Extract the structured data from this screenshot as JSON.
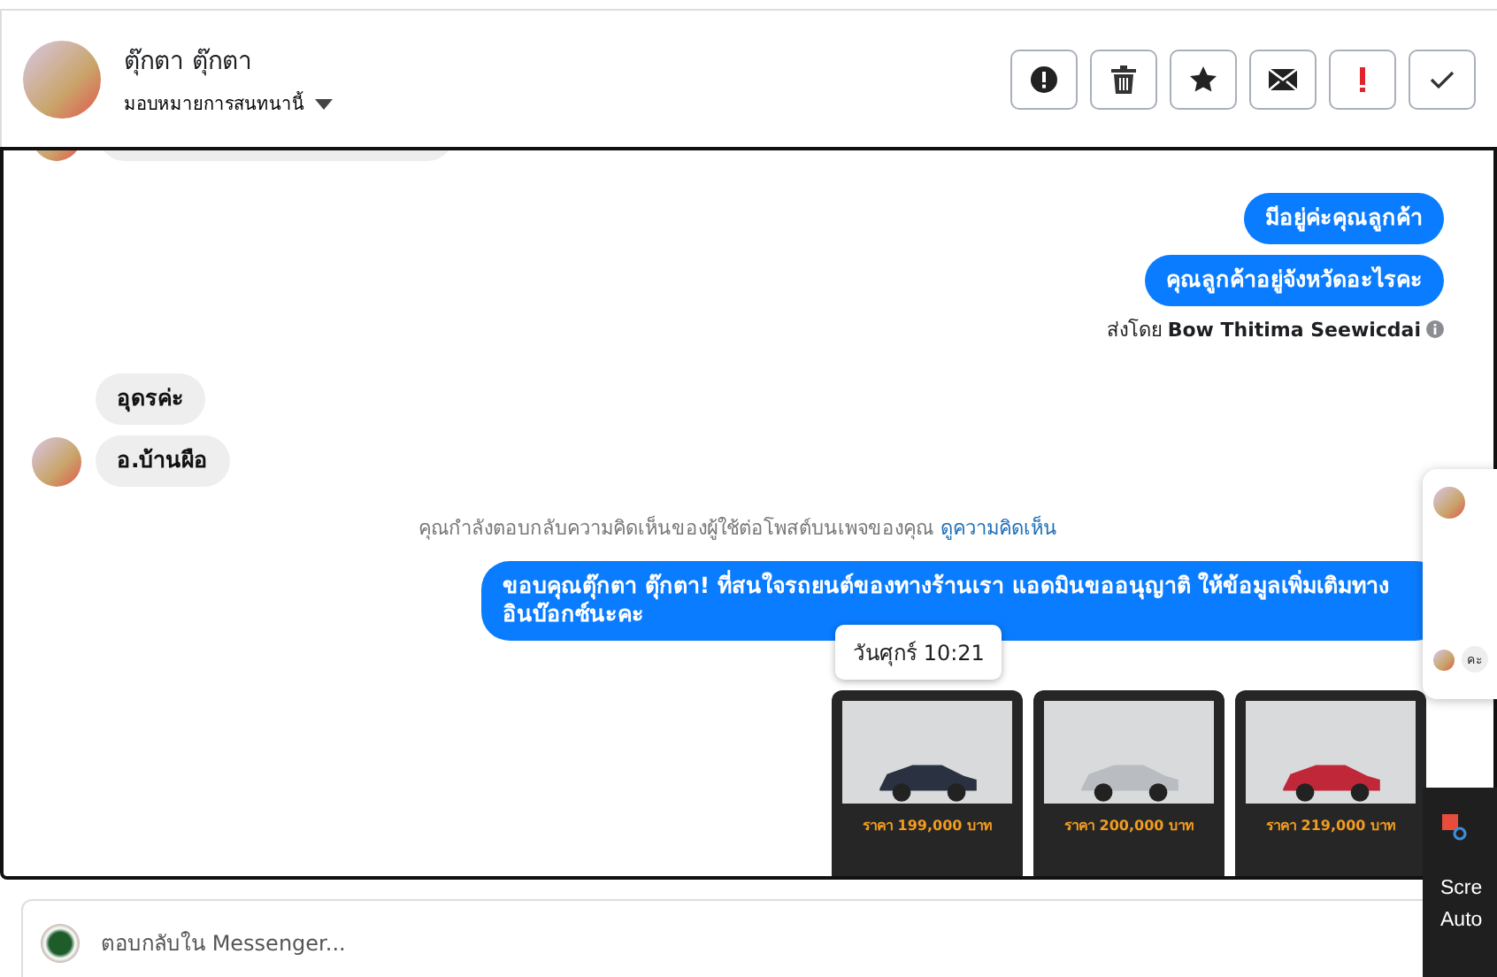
{
  "header": {
    "name": "ตุ๊กตา ตุ๊กตา",
    "assign": "มอบหมายการสนทนานี้"
  },
  "actions": [
    {
      "kind": "report"
    },
    {
      "kind": "delete"
    },
    {
      "kind": "star"
    },
    {
      "kind": "mail"
    },
    {
      "kind": "important"
    },
    {
      "kind": "done"
    }
  ],
  "messages": [
    {
      "kind": "out",
      "text": "มีอยู่ค่ะคุณลูกค้า"
    },
    {
      "kind": "out",
      "text": "คุณลูกค้าอยู่จังหวัดอะไรคะ"
    },
    {
      "kind": "sender",
      "text": "ส่งโดย **Bow Thitima Seewicdai**"
    },
    {
      "kind": "in",
      "text": "อุดรค่ะ"
    },
    {
      "kind": "in",
      "text": "อ.บ้านผือ"
    },
    {
      "kind": "notice",
      "text": "คุณกำลังตอบกลับความคิดเห็นของผู้ใช้ต่อโพสต์บนเพจของคุณ",
      "link": "ดูความคิดเห็น"
    },
    {
      "kind": "out",
      "text": "ขอบคุณตุ๊กตา ตุ๊กตา! ที่สนใจรถยนต์ของทางร้านเรา แอดมินขออนุญาติ ให้ข้อมูลเพิ่มเติมทาง อินบ๊อกซ์นะคะ"
    }
  ],
  "tooltip": "วันศุกร์ 10:21",
  "cars": [
    {
      "price": "ราคา 199,000 บาท",
      "color": "#2a3140"
    },
    {
      "price": "ราคา 200,000 บาท",
      "color": "#b9bcc0"
    },
    {
      "price": "ราคา 219,000 บาท",
      "color": "#c0283a"
    }
  ],
  "reply": {
    "placeholder": "ตอบกลับใน Messenger..."
  },
  "popup": {
    "bubble": "คะ"
  },
  "toast": {
    "title": "Scre",
    "body": "Auto"
  }
}
